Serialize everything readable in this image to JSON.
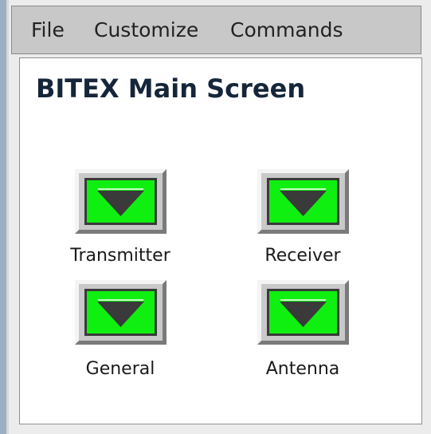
{
  "menubar": {
    "items": [
      {
        "label": "File"
      },
      {
        "label": "Customize"
      },
      {
        "label": "Commands"
      }
    ]
  },
  "main": {
    "title": "BITEX Main Screen",
    "buttons": [
      {
        "label": "Transmitter",
        "icon": "down-triangle-icon"
      },
      {
        "label": "Receiver",
        "icon": "down-triangle-icon"
      },
      {
        "label": "General",
        "icon": "down-triangle-icon"
      },
      {
        "label": "Antenna",
        "icon": "down-triangle-icon"
      }
    ]
  },
  "colors": {
    "button_face": "#10f010",
    "triangle": "#3a3a3a",
    "title_text": "#16263a",
    "menubar_bg": "#c8c8c8"
  }
}
